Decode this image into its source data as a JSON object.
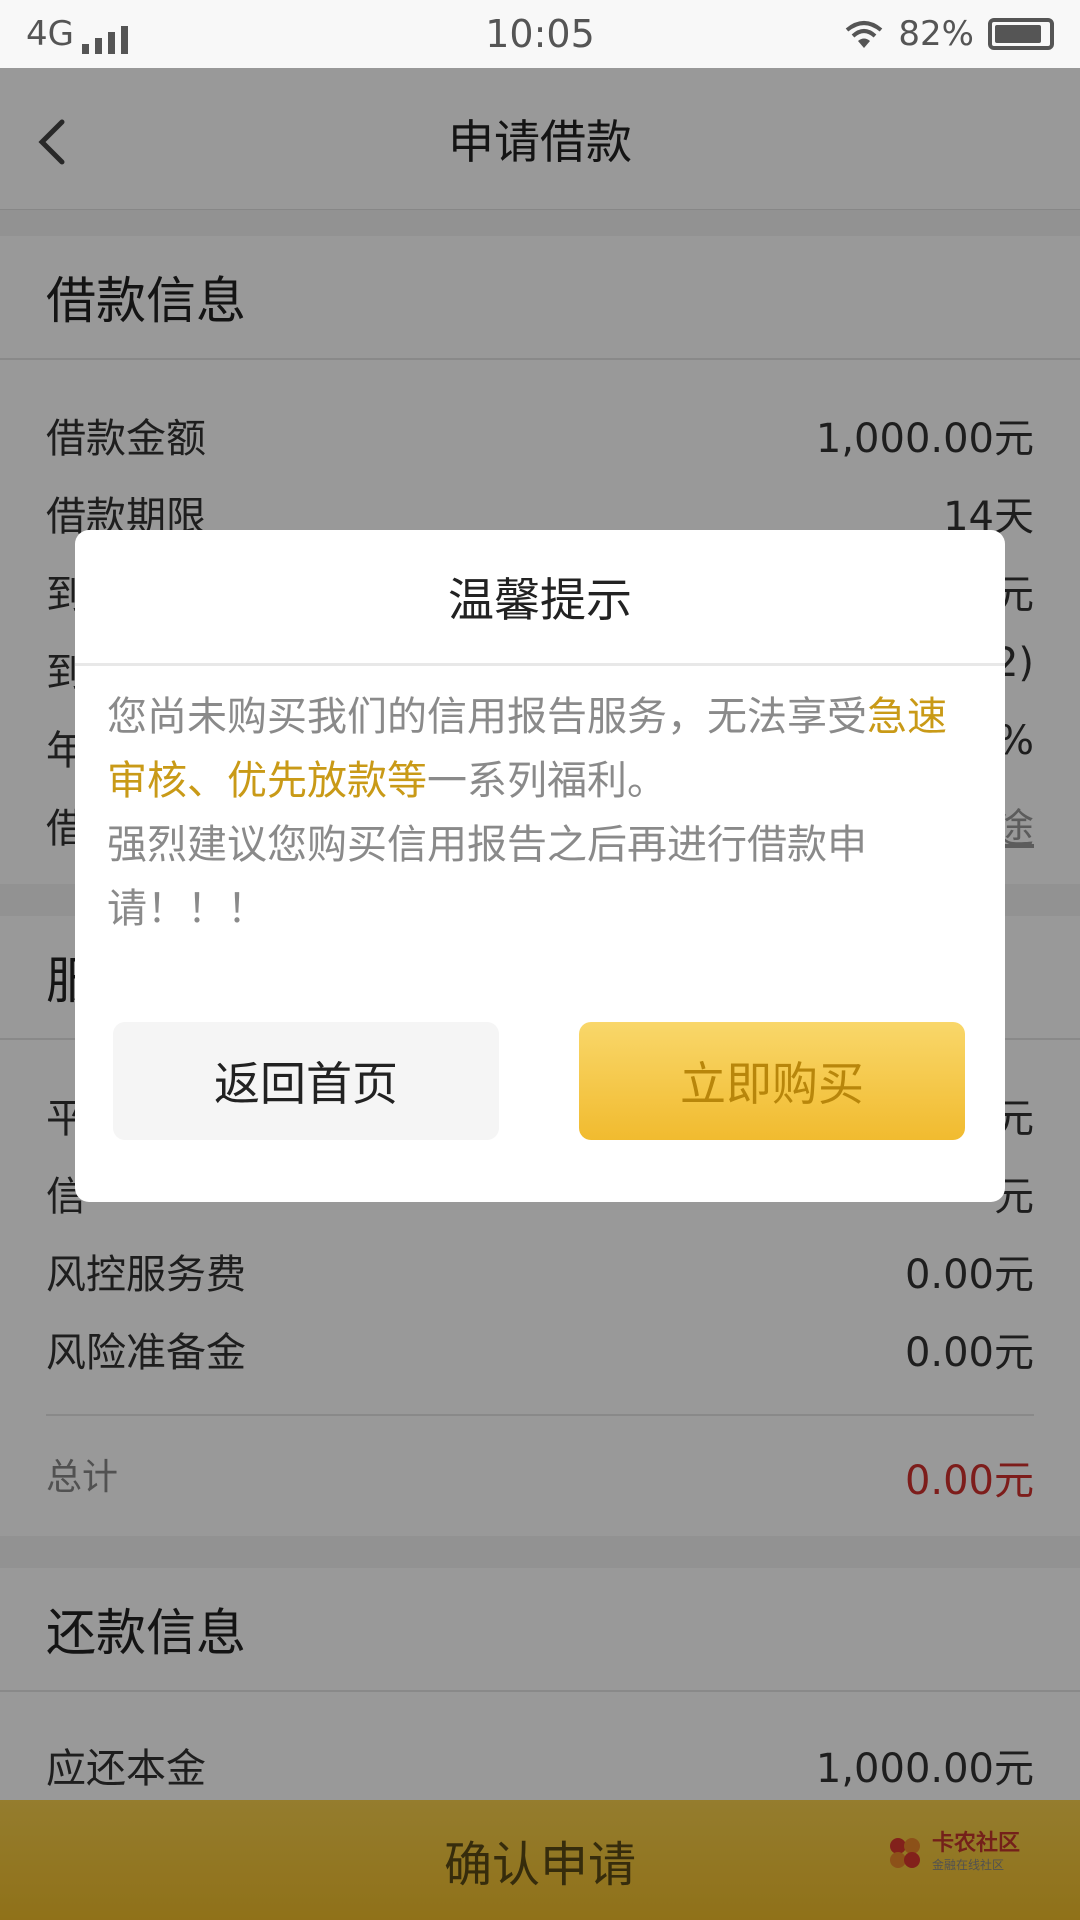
{
  "status_bar": {
    "network": "4G",
    "time": "10:05",
    "battery": "82%"
  },
  "nav": {
    "title": "申请借款"
  },
  "loan_info": {
    "header": "借款信息",
    "rows": [
      {
        "label": "借款金额",
        "value": "1,000.00元"
      },
      {
        "label": "借款期限",
        "value": "14天"
      },
      {
        "label": "到",
        "value": "元"
      },
      {
        "label": "到",
        "value": "2)"
      },
      {
        "label": "年",
        "value": "%"
      },
      {
        "label": "借",
        "value": "途"
      }
    ]
  },
  "service_info": {
    "header": "服",
    "rows": [
      {
        "label": "平",
        "value": "元"
      },
      {
        "label": "信",
        "value": "元"
      },
      {
        "label": "风控服务费",
        "value": "0.00元"
      },
      {
        "label": "风险准备金",
        "value": "0.00元"
      }
    ],
    "total_label": "总计",
    "total_value": "0.00元",
    "total_color": "#d0312d"
  },
  "repay_info": {
    "header": "还款信息",
    "rows": [
      {
        "label": "应还本金",
        "value": "1,000.00元"
      }
    ]
  },
  "confirm_button": "确认申请",
  "watermark": {
    "name": "卡农社区",
    "sub": "金融在线社区"
  },
  "dialog": {
    "title": "温馨提示",
    "line1_normal": "您尚未购买我们的信用报告服务，无法享受",
    "line1_highlight": "急速审核、优先放款等",
    "line1_tail": "一系列福利。",
    "line2": "强烈建议您购买信用报告之后再进行借款申请！！！",
    "highlight_color": "#c99a17",
    "btn_home": "返回首页",
    "btn_buy": "立即购买"
  },
  "icons": {
    "back": "back-arrow-icon",
    "signal": "signal-icon",
    "wifi": "wifi-icon",
    "battery": "battery-icon",
    "logo": "kanong-logo-icon"
  }
}
